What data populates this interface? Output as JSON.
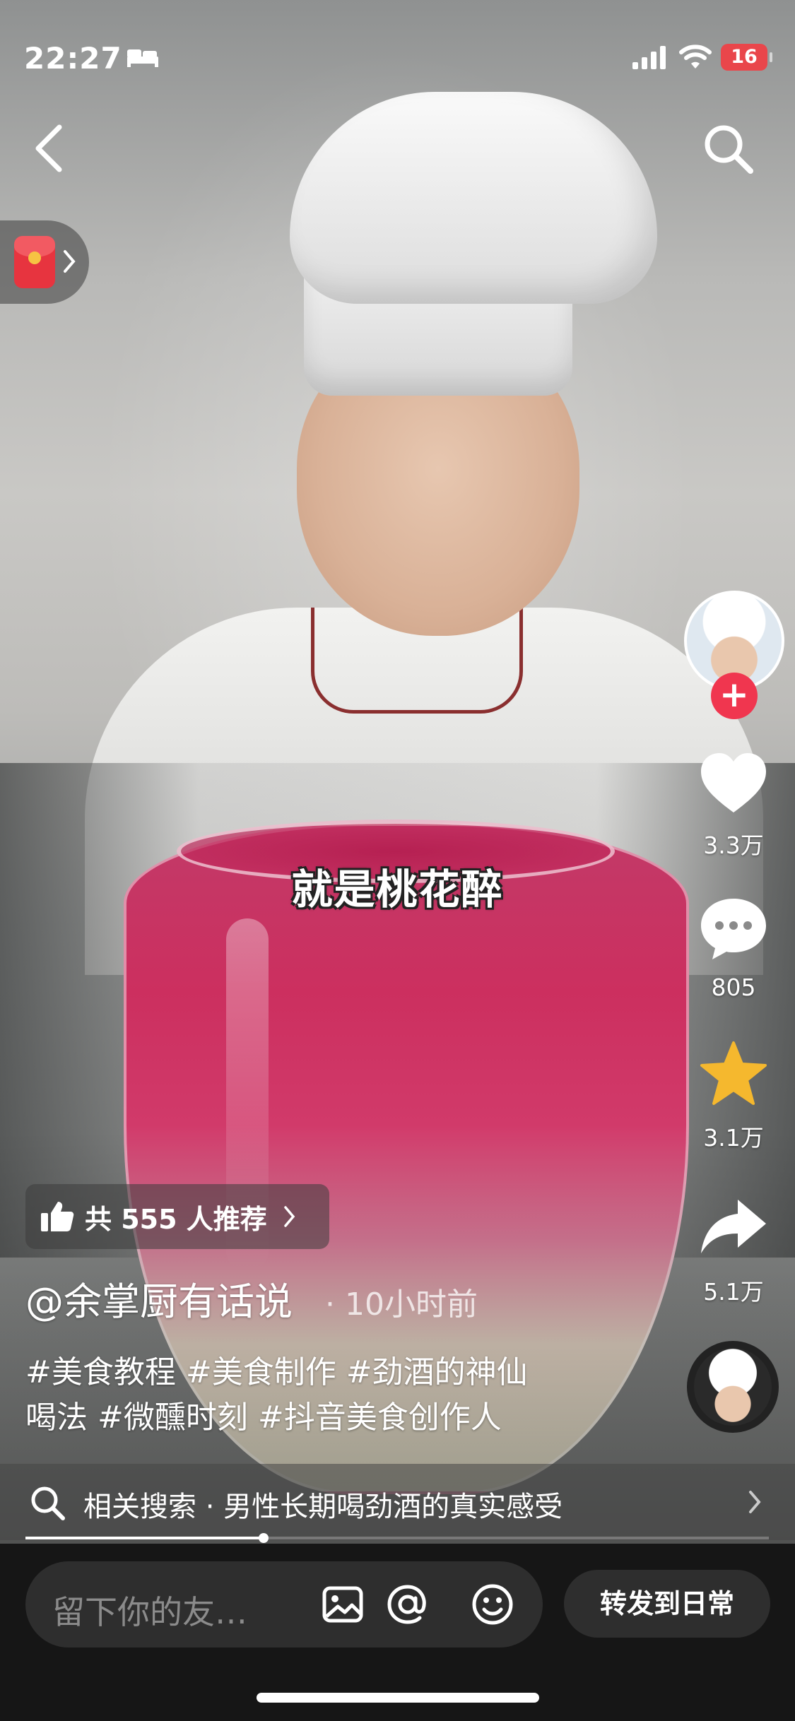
{
  "status_bar": {
    "time": "22:27",
    "battery": "16",
    "battery_color": "#e9464b",
    "icons": [
      "bed-icon",
      "signal-icon",
      "wifi-icon"
    ]
  },
  "nav": {
    "back_icon": "chevron-left-icon",
    "search_icon": "search-icon",
    "redpacket_icon": "red-packet-icon"
  },
  "video": {
    "subtitle": "就是桃花醉"
  },
  "right_rail": {
    "follow_symbol": "+",
    "like_count": "3.3万",
    "comment_count": "805",
    "favorite_count": "3.1万",
    "share_count": "5.1万",
    "accent_follow": "#f0364f",
    "favorite_color": "#f5b82e"
  },
  "caption": {
    "recommend": "共 555 人推荐",
    "author": "@余掌厨有话说",
    "time": "10小时前",
    "hashtags_line1": "#美食教程 #美食制作 #劲酒的神仙",
    "hashtags_line2": "喝法 #微醺时刻 #抖音美食创作人"
  },
  "related_search": {
    "text": "相关搜索 · 男性长期喝劲酒的真实感受"
  },
  "progress": {
    "played_fraction": 0.32
  },
  "bottom": {
    "comment_placeholder": "留下你的友…",
    "forward_label": "转发到日常",
    "icons": [
      "image-icon",
      "at-icon",
      "emoji-icon"
    ]
  }
}
